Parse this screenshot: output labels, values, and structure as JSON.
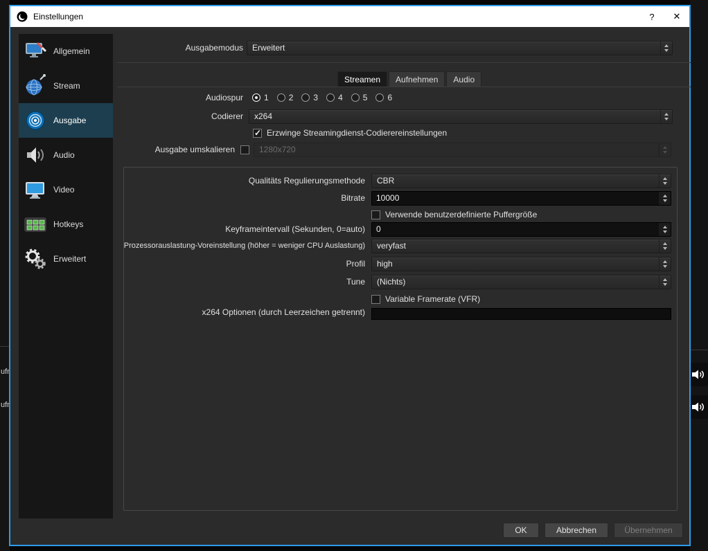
{
  "window": {
    "title": "Einstellungen",
    "help_label": "?",
    "close_label": "✕"
  },
  "colors": {
    "accent_border": "#2e9ceb",
    "titlebar_bg": "#ffffff",
    "dialog_bg": "#2b2b2b",
    "sidebar_bg": "#161616",
    "sidebar_selected": "#1d3e4e"
  },
  "sidebar": {
    "items": [
      {
        "label": "Allgemein",
        "icon": "general-icon",
        "selected": false
      },
      {
        "label": "Stream",
        "icon": "stream-icon",
        "selected": false
      },
      {
        "label": "Ausgabe",
        "icon": "output-icon",
        "selected": true
      },
      {
        "label": "Audio",
        "icon": "audio-icon",
        "selected": false
      },
      {
        "label": "Video",
        "icon": "video-icon",
        "selected": false
      },
      {
        "label": "Hotkeys",
        "icon": "hotkeys-icon",
        "selected": false
      },
      {
        "label": "Erweitert",
        "icon": "advanced-icon",
        "selected": false
      }
    ]
  },
  "output_mode": {
    "label": "Ausgabemodus",
    "value": "Erweitert"
  },
  "tabs": [
    {
      "label": "Streamen",
      "active": true
    },
    {
      "label": "Aufnehmen",
      "active": false
    },
    {
      "label": "Audio",
      "active": false
    }
  ],
  "stream_tab": {
    "audio_track": {
      "label": "Audiospur",
      "options": [
        "1",
        "2",
        "3",
        "4",
        "5",
        "6"
      ],
      "selected": "1"
    },
    "encoder": {
      "label": "Codierer",
      "value": "x264"
    },
    "enforce_checkbox": {
      "label": "Erzwinge Streamingdienst-Codierereinstellungen",
      "checked": true
    },
    "rescale": {
      "label": "Ausgabe umskalieren",
      "checked": false,
      "value": "1280x720"
    },
    "rate_control": {
      "label": "Qualitäts Regulierungsmethode",
      "value": "CBR"
    },
    "bitrate": {
      "label": "Bitrate",
      "value": "10000"
    },
    "custom_buffer": {
      "label": "Verwende benutzerdefinierte Puffergröße",
      "checked": false
    },
    "keyframe": {
      "label": "Keyframeintervall (Sekunden, 0=auto)",
      "value": "0"
    },
    "cpu_preset": {
      "label": "Prozessorauslastung-Voreinstellung (höher = weniger CPU Auslastung)",
      "value": "veryfast"
    },
    "profile": {
      "label": "Profil",
      "value": "high"
    },
    "tune": {
      "label": "Tune",
      "value": "(Nichts)"
    },
    "vfr": {
      "label": "Variable Framerate (VFR)",
      "checked": false
    },
    "x264_options": {
      "label": "x264 Optionen (durch Leerzeichen getrennt)",
      "value": ""
    }
  },
  "footer": {
    "ok": "OK",
    "cancel": "Abbrechen",
    "apply": "Übernehmen"
  },
  "background": {
    "left_fragments": [
      "ufn",
      "ufna"
    ]
  }
}
